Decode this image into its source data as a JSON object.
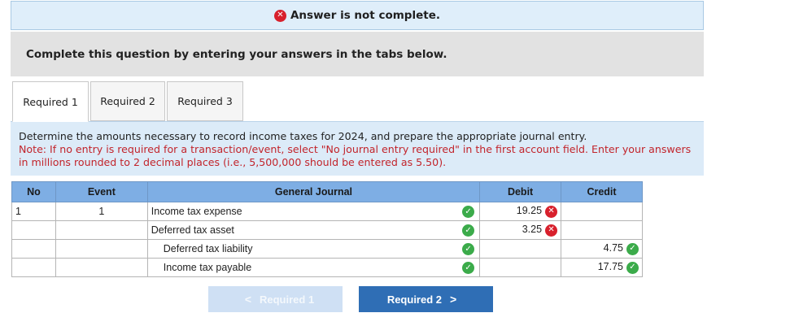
{
  "status": {
    "message": "Answer is not complete.",
    "icon": "x-circle-icon",
    "icon_color": "#d8202c"
  },
  "instructions": "Complete this question by entering your answers in the tabs below.",
  "tabs": [
    {
      "label": "Required 1",
      "active": true
    },
    {
      "label": "Required 2",
      "active": false
    },
    {
      "label": "Required 3",
      "active": false
    }
  ],
  "panel": {
    "description": "Determine the amounts necessary to record income taxes for 2024, and prepare the appropriate journal entry.",
    "note": "Note: If no entry is required for a transaction/event, select \"No journal entry required\" in the first account field. Enter your answers in millions rounded to 2 decimal places (i.e., 5,500,000 should be entered as 5.50)."
  },
  "journal": {
    "headers": [
      "No",
      "Event",
      "General Journal",
      "Debit",
      "Credit"
    ],
    "rows": [
      {
        "no": "1",
        "event": "1",
        "account": "Income tax expense",
        "indent": false,
        "account_correct": true,
        "debit": "19.25",
        "debit_status": "incorrect",
        "credit": "",
        "credit_status": ""
      },
      {
        "no": "",
        "event": "",
        "account": "Deferred tax asset",
        "indent": false,
        "account_correct": true,
        "debit": "3.25",
        "debit_status": "incorrect",
        "credit": "",
        "credit_status": ""
      },
      {
        "no": "",
        "event": "",
        "account": "Deferred tax liability",
        "indent": true,
        "account_correct": true,
        "debit": "",
        "debit_status": "",
        "credit": "4.75",
        "credit_status": "correct"
      },
      {
        "no": "",
        "event": "",
        "account": "Income tax payable",
        "indent": true,
        "account_correct": true,
        "debit": "",
        "debit_status": "",
        "credit": "17.75",
        "credit_status": "correct"
      }
    ]
  },
  "nav": {
    "prev_label": "Required 1",
    "next_label": "Required 2",
    "prev_icon": "chevron-left-icon",
    "next_icon": "chevron-right-icon"
  },
  "colors": {
    "accent": "#2f6eb5",
    "header_blue": "#7eaee4",
    "correct": "#3bab4a",
    "incorrect": "#d8202c",
    "note_red": "#c2242b"
  }
}
